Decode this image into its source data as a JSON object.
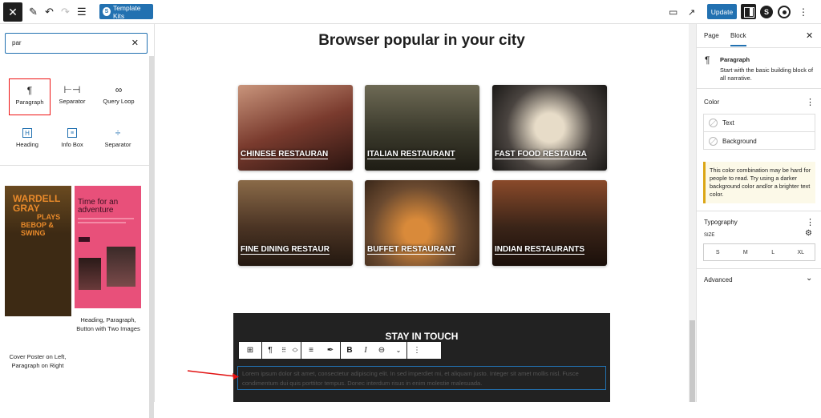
{
  "topbar": {
    "template_kits": "Template Kits",
    "update": "Update"
  },
  "inserter": {
    "search_value": "par",
    "blocks": [
      {
        "label": "Paragraph",
        "icon": "pilcrow-icon"
      },
      {
        "label": "Separator",
        "icon": "separator-icon"
      },
      {
        "label": "Query Loop",
        "icon": "loop-icon"
      },
      {
        "label": "Heading",
        "icon": "heading-icon"
      },
      {
        "label": "Info Box",
        "icon": "infobox-icon"
      },
      {
        "label": "Separator",
        "icon": "separator-icon"
      }
    ],
    "patterns": [
      {
        "label": "Cover Poster on Left, Paragraph on Right",
        "poster_text": [
          "WARDELL",
          "GRAY",
          "PLAYS",
          "BEBOP &",
          "SWING"
        ]
      },
      {
        "label": "Heading, Paragraph, Button with Two Images",
        "poster_text": [
          "Time for an",
          "adventure"
        ]
      }
    ]
  },
  "canvas": {
    "title": "Browser popular in your city",
    "cards": [
      {
        "label": "CHINESE RESTAURAN",
        "color": "#7a3b2e"
      },
      {
        "label": "ITALIAN RESTAURANT",
        "color": "#3b3a2c"
      },
      {
        "label": "FAST FOOD RESTAURA",
        "color": "#4a4440"
      },
      {
        "label": "FINE DINING RESTAUR",
        "color": "#4b3424"
      },
      {
        "label": "BUFFET RESTAURANT",
        "color": "#6b4a30"
      },
      {
        "label": "INDIAN RESTAURANTS",
        "color": "#3a2418"
      }
    ],
    "section_heading": "STAY IN TOUCH",
    "paragraph": "Lorem ipsum dolor sit amet, consectetur adipiscing elit. In sed imperdiet mi, et aliquam justo. Integer sit amet mollis nisl. Fusce condimentum dui quis porttitor tempus. Donec interdum risus in enim molestie malesuada."
  },
  "sidebar": {
    "tabs": [
      "Page",
      "Block"
    ],
    "block_name": "Paragraph",
    "block_desc": "Start with the basic building block of all narrative.",
    "color_title": "Color",
    "color_text": "Text",
    "color_background": "Background",
    "warning": "This color combination may be hard for people to read. Try using a darker background color and/or a brighter text color.",
    "typography_title": "Typography",
    "size_label": "SIZE",
    "sizes": [
      "S",
      "M",
      "L",
      "XL"
    ],
    "advanced_title": "Advanced"
  },
  "colors": {
    "accent": "#2271b1",
    "annotation": "#e11111"
  }
}
